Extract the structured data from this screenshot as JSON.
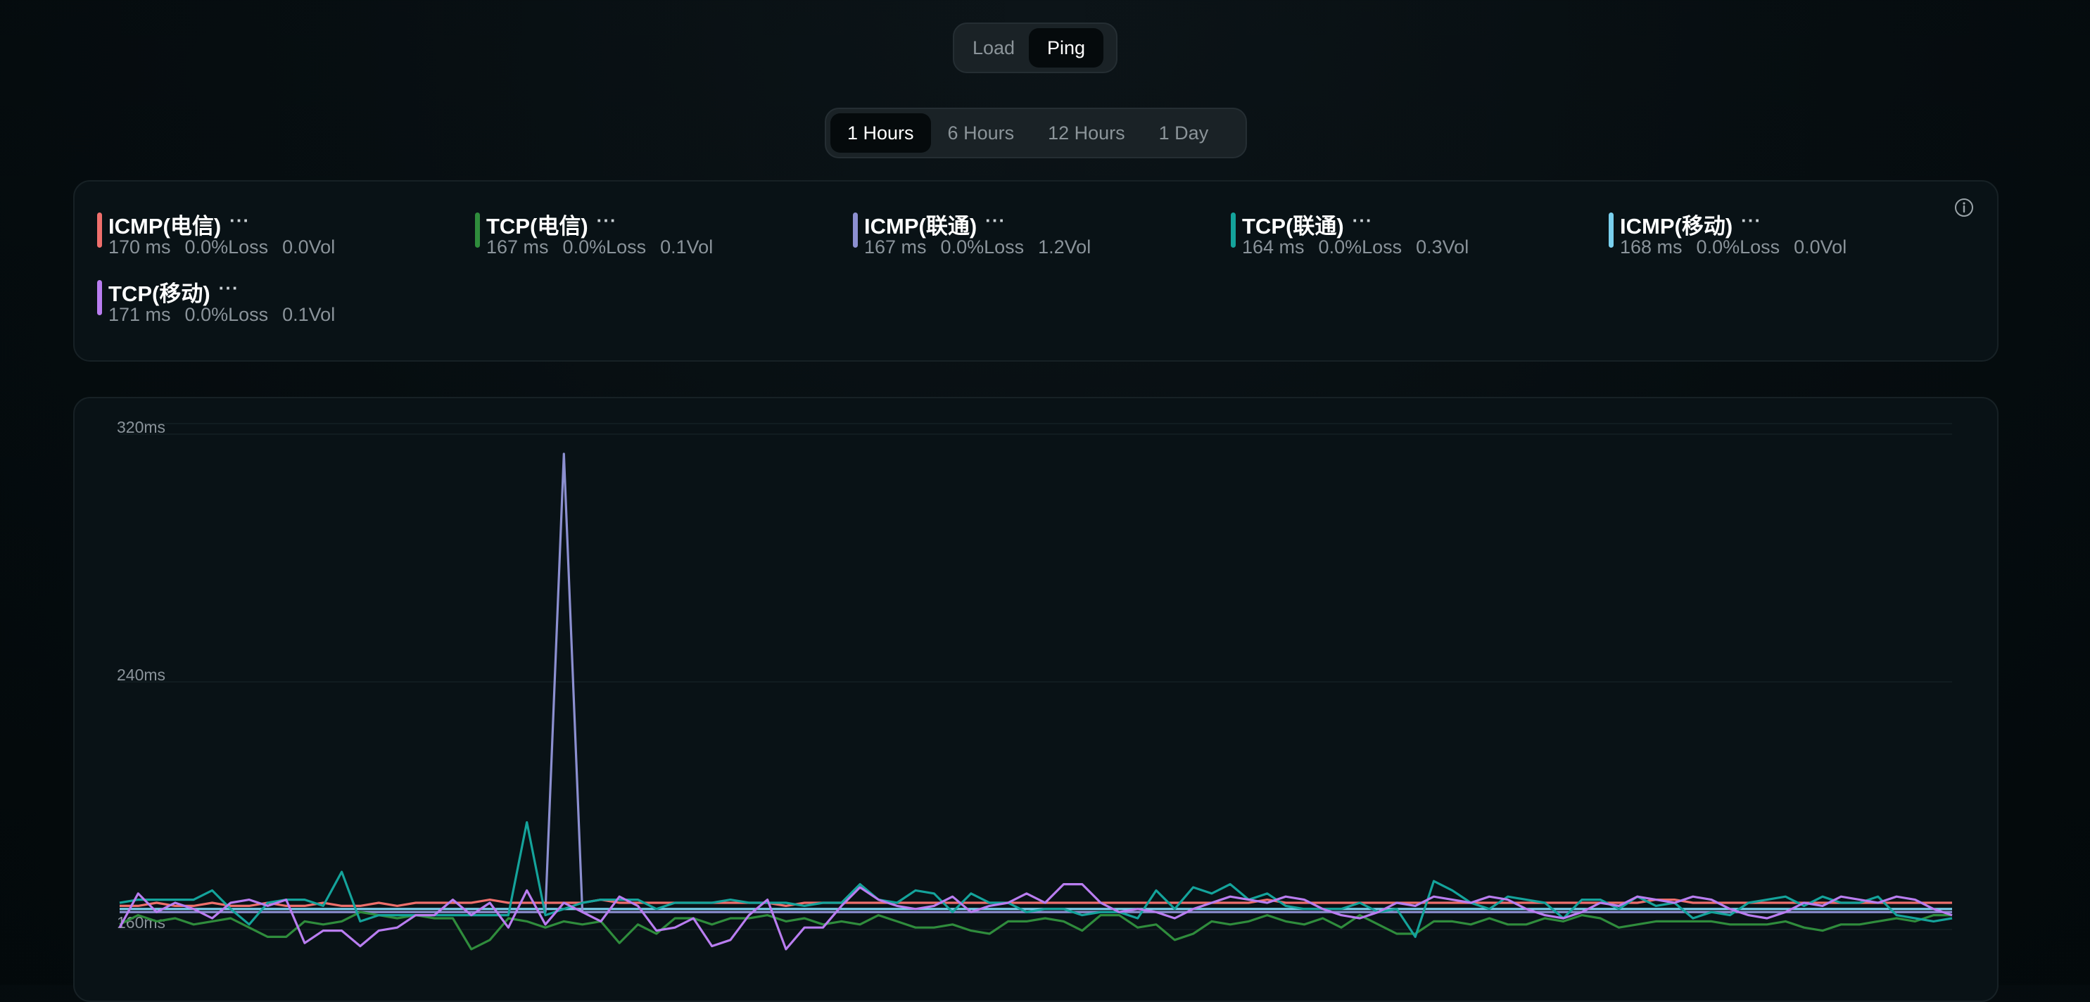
{
  "view_toggle": {
    "options": [
      "Load",
      "Ping"
    ],
    "selected": "Ping"
  },
  "range_toggle": {
    "options": [
      "1 Hours",
      "6 Hours",
      "12 Hours",
      "1 Day"
    ],
    "selected": "1 Hours"
  },
  "legend": {
    "more_label": "···",
    "items": [
      {
        "name": "ICMP(电信)",
        "latency": "170 ms",
        "loss": "0.0%Loss",
        "vol": "0.0Vol",
        "color": "#ef6f6c"
      },
      {
        "name": "TCP(电信)",
        "latency": "167 ms",
        "loss": "0.0%Loss",
        "vol": "0.1Vol",
        "color": "#2f8c3c"
      },
      {
        "name": "ICMP(联通)",
        "latency": "167 ms",
        "loss": "0.0%Loss",
        "vol": "1.2Vol",
        "color": "#8c8fd0"
      },
      {
        "name": "TCP(联通)",
        "latency": "164 ms",
        "loss": "0.0%Loss",
        "vol": "0.3Vol",
        "color": "#14a39b"
      },
      {
        "name": "ICMP(移动)",
        "latency": "168 ms",
        "loss": "0.0%Loss",
        "vol": "0.0Vol",
        "color": "#7ad0ee"
      },
      {
        "name": "TCP(移动)",
        "latency": "171 ms",
        "loss": "0.0%Loss",
        "vol": "0.1Vol",
        "color": "#b97df0"
      }
    ]
  },
  "icons": {
    "info": "info-icon",
    "more": "more-icon"
  },
  "chart_data": {
    "type": "line",
    "y_ticks": [
      "320ms",
      "240ms",
      "160ms"
    ],
    "y_tick_values": [
      320,
      240,
      160
    ],
    "ylim": [
      140,
      330
    ],
    "grid": true,
    "series": [
      {
        "name": "ICMP(电信)",
        "color": "#ef6f6c",
        "values": [
          169,
          169,
          170,
          169,
          169,
          170,
          169,
          169,
          170,
          169,
          169,
          170,
          169,
          169,
          170,
          169,
          170,
          170,
          170,
          170,
          171,
          170,
          170,
          170,
          170,
          170,
          171,
          170,
          170,
          170,
          170,
          170,
          170,
          170,
          170,
          170,
          169,
          170,
          170,
          170,
          170,
          170,
          170,
          170,
          170,
          170,
          170,
          170,
          170,
          170,
          170,
          170,
          170,
          170,
          170,
          170,
          170,
          170,
          170,
          170,
          170,
          170,
          171,
          170,
          170,
          170,
          170,
          170,
          170,
          170,
          170,
          170,
          170,
          170,
          170,
          170,
          170,
          170,
          170,
          170,
          170,
          170,
          170,
          171,
          171,
          170,
          170,
          170,
          170,
          170,
          170,
          170,
          170,
          170,
          170,
          170,
          170,
          170,
          170,
          170
        ]
      },
      {
        "name": "TCP(电信)",
        "color": "#2f8c3c",
        "values": [
          163,
          166,
          164,
          165,
          163,
          164,
          165,
          162,
          159,
          159,
          164,
          163,
          164,
          167,
          166,
          165,
          166,
          165,
          165,
          155,
          158,
          165,
          164,
          162,
          164,
          163,
          164,
          157,
          163,
          160,
          165,
          165,
          163,
          165,
          165,
          166,
          164,
          165,
          163,
          164,
          163,
          166,
          164,
          162,
          162,
          163,
          161,
          160,
          164,
          164,
          165,
          164,
          161,
          166,
          166,
          162,
          163,
          158,
          160,
          164,
          163,
          164,
          166,
          164,
          163,
          165,
          162,
          166,
          163,
          160,
          160,
          164,
          164,
          163,
          165,
          163,
          163,
          165,
          164,
          166,
          165,
          162,
          163,
          164,
          164,
          164,
          164,
          163,
          163,
          163,
          164,
          162,
          161,
          163,
          163,
          164,
          165,
          164,
          166,
          166
        ]
      },
      {
        "name": "ICMP(联通)",
        "color": "#8c8fd0",
        "values": [
          167,
          167,
          167,
          167,
          167,
          167,
          167,
          167,
          167,
          167,
          167,
          167,
          167,
          167,
          167,
          167,
          167,
          167,
          167,
          167,
          167,
          167,
          167,
          167,
          315,
          167,
          167,
          167,
          167,
          167,
          167,
          167,
          167,
          167,
          167,
          167,
          167,
          167,
          167,
          167,
          167,
          167,
          167,
          167,
          167,
          167,
          167,
          167,
          167,
          167,
          167,
          167,
          167,
          167,
          167,
          167,
          167,
          167,
          167,
          167,
          167,
          167,
          167,
          167,
          167,
          167,
          167,
          167,
          167,
          167,
          167,
          167,
          167,
          167,
          167,
          167,
          167,
          167,
          167,
          167,
          167,
          167,
          167,
          167,
          167,
          167,
          167,
          167,
          167,
          167,
          167,
          167,
          167,
          167,
          167,
          167,
          167,
          167,
          167,
          167
        ]
      },
      {
        "name": "TCP(联通)",
        "color": "#14a39b",
        "values": [
          170,
          171,
          171,
          171,
          171,
          174,
          168,
          163,
          170,
          171,
          171,
          169,
          180,
          164,
          166,
          166,
          166,
          166,
          166,
          166,
          166,
          166,
          196,
          166,
          168,
          170,
          171,
          171,
          171,
          168,
          170,
          170,
          170,
          171,
          170,
          170,
          170,
          169,
          170,
          170,
          176,
          171,
          170,
          174,
          173,
          167,
          173,
          170,
          170,
          167,
          168,
          168,
          166,
          167,
          167,
          165,
          174,
          168,
          175,
          173,
          176,
          171,
          173,
          169,
          168,
          168,
          168,
          170,
          167,
          168,
          159,
          177,
          174,
          170,
          168,
          172,
          171,
          170,
          165,
          171,
          171,
          168,
          172,
          169,
          170,
          165,
          167,
          166,
          170,
          171,
          172,
          169,
          172,
          170,
          170,
          172,
          166,
          165,
          164,
          165
        ]
      },
      {
        "name": "ICMP(移动)",
        "color": "#7ad0ee",
        "values": [
          168,
          168,
          168,
          168,
          168,
          168,
          168,
          168,
          168,
          168,
          168,
          168,
          168,
          168,
          168,
          168,
          168,
          168,
          168,
          168,
          168,
          168,
          168,
          168,
          168,
          168,
          168,
          168,
          168,
          168,
          168,
          168,
          168,
          168,
          168,
          168,
          168,
          168,
          168,
          168,
          168,
          168,
          168,
          168,
          168,
          168,
          168,
          168,
          168,
          168,
          168,
          168,
          168,
          168,
          168,
          168,
          168,
          168,
          168,
          168,
          168,
          168,
          168,
          168,
          168,
          168,
          168,
          168,
          168,
          168,
          168,
          168,
          168,
          168,
          168,
          168,
          168,
          168,
          168,
          168,
          168,
          168,
          168,
          168,
          168,
          168,
          168,
          168,
          168,
          168,
          168,
          168,
          168,
          168,
          168,
          168,
          168,
          168,
          168,
          168
        ]
      },
      {
        "name": "TCP(移动)",
        "color": "#b97df0",
        "values": [
          162,
          173,
          167,
          170,
          168,
          165,
          170,
          171,
          169,
          171,
          157,
          161,
          161,
          156,
          161,
          162,
          166,
          166,
          171,
          166,
          170,
          162,
          174,
          163,
          170,
          167,
          164,
          172,
          169,
          161,
          162,
          165,
          156,
          158,
          166,
          171,
          155,
          162,
          162,
          169,
          175,
          171,
          169,
          168,
          169,
          172,
          167,
          169,
          170,
          173,
          170,
          176,
          176,
          170,
          167,
          168,
          167,
          165,
          168,
          170
        ],
        "values_tail": [
          172,
          171,
          170,
          172,
          171,
          168,
          166,
          165,
          167,
          170,
          169
        ]
      }
    ]
  }
}
